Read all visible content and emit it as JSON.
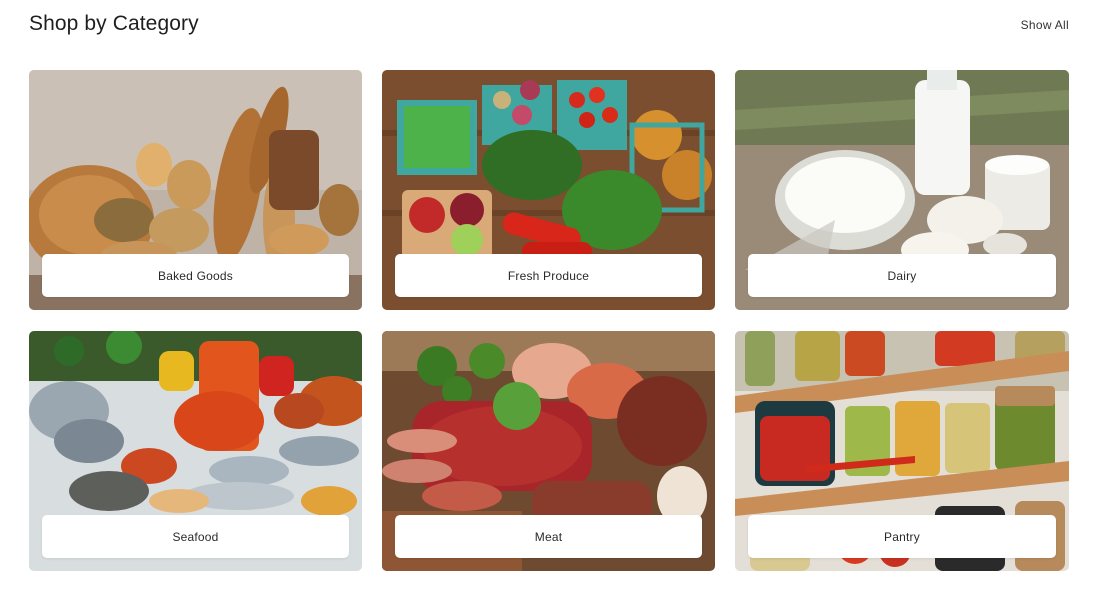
{
  "section": {
    "title": "Shop by Category",
    "show_all_label": "Show All"
  },
  "categories": [
    {
      "label": "Baked Goods",
      "icon": "bread-image"
    },
    {
      "label": "Fresh Produce",
      "icon": "vegetables-image"
    },
    {
      "label": "Dairy",
      "icon": "dairy-image"
    },
    {
      "label": "Seafood",
      "icon": "seafood-image"
    },
    {
      "label": "Meat",
      "icon": "meat-image"
    },
    {
      "label": "Pantry",
      "icon": "pantry-image"
    }
  ],
  "colors": {
    "label_background": "#ffffff",
    "title_text": "#1f1f1f"
  }
}
